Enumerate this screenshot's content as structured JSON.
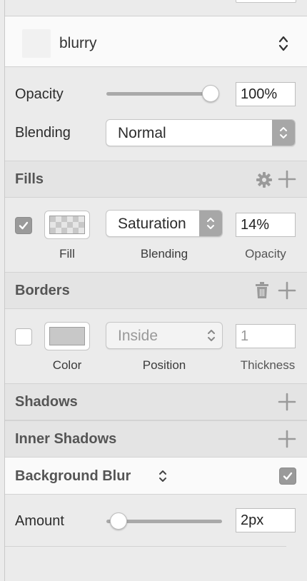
{
  "style": {
    "name": "blurry"
  },
  "layer": {
    "opacity_label": "Opacity",
    "opacity_value": "100%",
    "opacity_level": 1.0,
    "blending_label": "Blending",
    "blending_value": "Normal"
  },
  "fills": {
    "title": "Fills",
    "enabled": true,
    "blend_mode": "Saturation",
    "opacity": "14%",
    "labels": {
      "fill": "Fill",
      "blending": "Blending",
      "opacity": "Opacity"
    }
  },
  "borders": {
    "title": "Borders",
    "enabled": false,
    "position": "Inside",
    "thickness": "1",
    "labels": {
      "color": "Color",
      "position": "Position",
      "thickness": "Thickness"
    }
  },
  "shadows": {
    "title": "Shadows"
  },
  "inner_shadows": {
    "title": "Inner Shadows"
  },
  "background_blur": {
    "title": "Background Blur",
    "enabled": true,
    "amount_label": "Amount",
    "amount_value": "2px",
    "amount_level": 0.05
  },
  "icons": {
    "updown": "chevron-updown-icon",
    "gear": "gear-icon",
    "plus": "plus-icon",
    "trash": "trash-icon",
    "check": "checkmark-icon"
  },
  "colors": {
    "panel_bg": "#ebebeb",
    "section_bg": "#e4e4e4",
    "stepper_bg": "#a7a7a7",
    "border_swatch": "#c8c8c8"
  }
}
